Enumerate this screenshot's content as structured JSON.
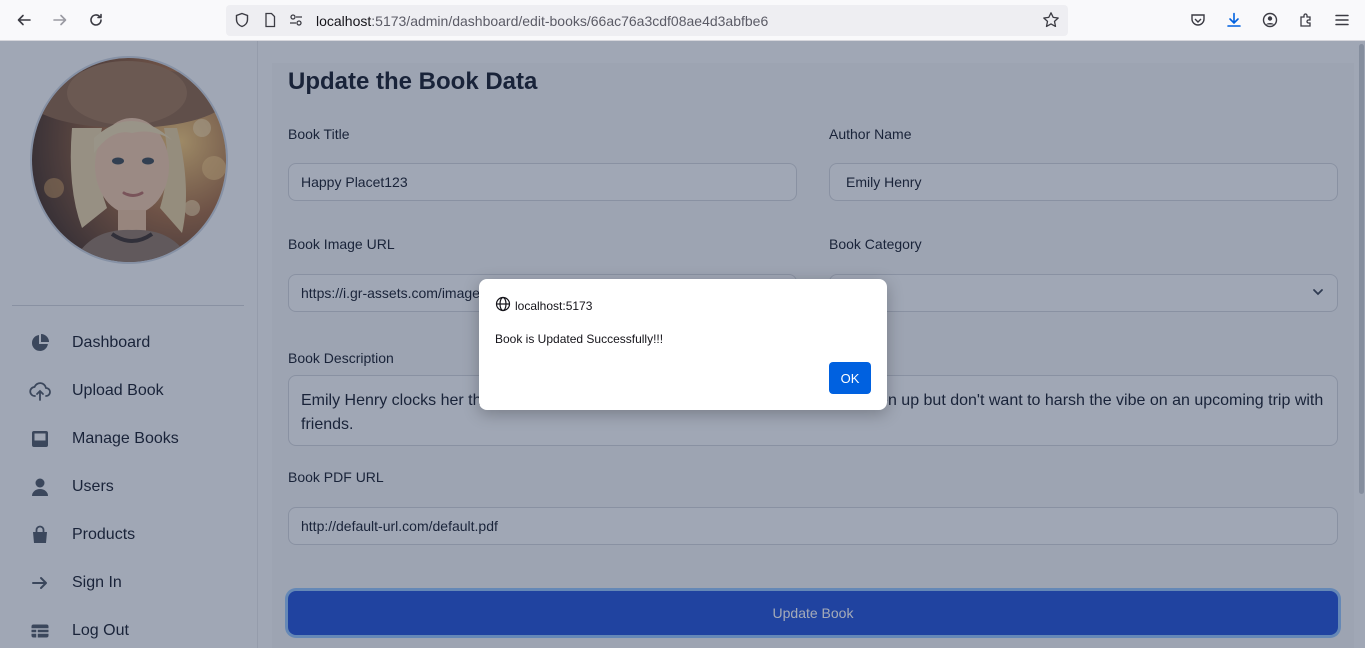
{
  "browser": {
    "url_host": "localhost",
    "url_rest": ":5173/admin/dashboard/edit-books/66ac76a3cdf08ae4d3abfbe6"
  },
  "sidebar": {
    "items": [
      {
        "label": "Dashboard",
        "icon": "chart-pie-icon"
      },
      {
        "label": "Upload Book",
        "icon": "cloud-upload-icon"
      },
      {
        "label": "Manage Books",
        "icon": "inbox-icon"
      },
      {
        "label": "Users",
        "icon": "user-icon"
      },
      {
        "label": "Products",
        "icon": "shopping-bag-icon"
      },
      {
        "label": "Sign In",
        "icon": "arrow-right-icon"
      },
      {
        "label": "Log Out",
        "icon": "table-icon"
      }
    ]
  },
  "form": {
    "title": "Update the Book Data",
    "book_title_label": "Book Title",
    "book_title_value": "Happy Placet123",
    "author_label": "Author Name",
    "author_value": "Emily Henry",
    "image_url_label": "Book Image URL",
    "image_url_value": "https://i.gr-assets.com/images/S/compressed.photo.goodreads.com/books/1",
    "category_label": "Book Category",
    "category_value": "",
    "description_label": "Book Description",
    "description_value": "Emily Henry clocks her third straight tale with this saga of a couple who have broken up but don't want to harsh the vibe on an upcoming trip with friends.",
    "pdf_label": "Book PDF URL",
    "pdf_value": "http://default-url.com/default.pdf",
    "submit_label": "Update Book"
  },
  "dialog": {
    "origin": "localhost:5173",
    "message": "Book is Updated Successfully!!!",
    "ok_label": "OK"
  },
  "colors": {
    "accent": "#1d4ed8",
    "dialog_button": "#0061e0"
  }
}
